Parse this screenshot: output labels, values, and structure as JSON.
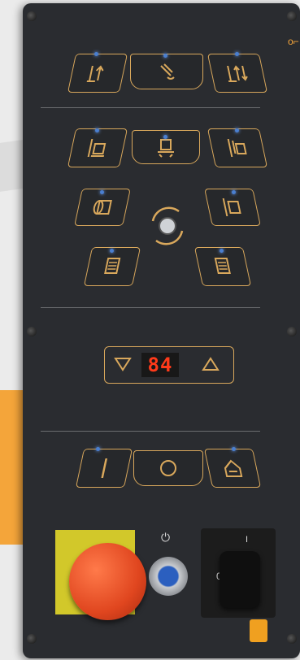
{
  "display": {
    "value": "84"
  },
  "power_button": {
    "symbol": "⏻"
  },
  "rotary_switch": {
    "pos_0": "0",
    "pos_1": "I"
  },
  "colors": {
    "panel": "#2a2c30",
    "accent": "#d9a85c",
    "led": "#4a7fd0",
    "segment": "#ff3a1a",
    "estop": "#e0461f"
  },
  "icons": {
    "row1": [
      "lift-up-icon",
      "hand-touch-icon",
      "lift-up-down-icon"
    ],
    "row2": [
      "pallet-left-icon",
      "platform-icon",
      "pallet-right-icon"
    ],
    "row3": [
      "roll-feed-icon",
      "rotate-icon",
      "pallet-box-icon"
    ],
    "row4": [
      "stack-left-icon",
      "stack-right-icon"
    ],
    "bottom": [
      "start-icon",
      "stop-icon",
      "home-icon"
    ]
  }
}
